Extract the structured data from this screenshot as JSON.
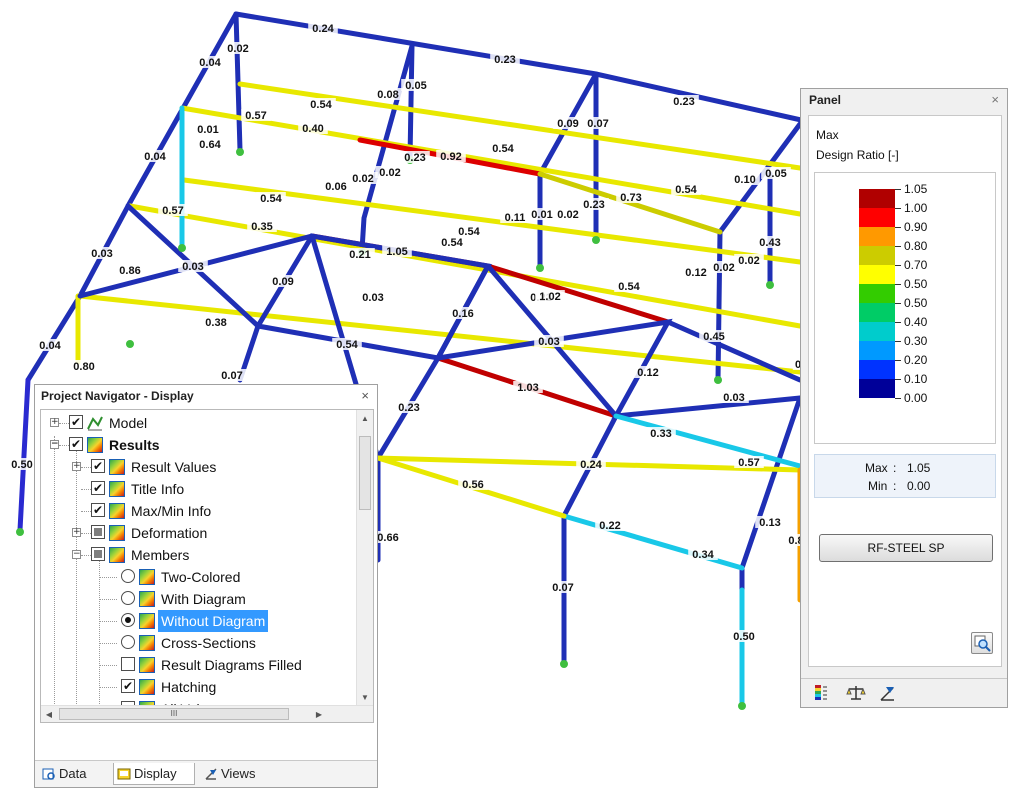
{
  "model": {
    "labels": [
      "0.24",
      "0.23",
      "0.23",
      "0.02",
      "0.04",
      "0.05",
      "0.08",
      "0.54",
      "0.57",
      "0.01",
      "0.64",
      "0.40",
      "0.92",
      "0.54",
      "0.09",
      "0.07",
      "0.10",
      "0.05",
      "0.04",
      "0.02",
      "0.02",
      "0.23",
      "0.06",
      "0.54",
      "0.73",
      "0.54",
      "0.57",
      "0.35",
      "0.11",
      "0.01",
      "0.02",
      "0.23",
      "0.21",
      "1.05",
      "0.54",
      "0.43",
      "0.03",
      "0.86",
      "0.03",
      "0.09",
      "0.02",
      "0.02",
      "0.12",
      "0.21",
      "1.02",
      "0.54",
      "0.54",
      "0.03",
      "0.38",
      "0.16",
      "0.03",
      "0.45",
      "0.04",
      "0.54",
      "0.80",
      "0.07",
      "0.12",
      "1.03",
      "0.23",
      "0.03",
      "0.50",
      "0.33",
      "0.57",
      "0.24",
      "0.56",
      "0.66",
      "0.22",
      "0.13",
      "0.34",
      "0.07",
      "0.50",
      "0.8",
      "0"
    ]
  },
  "navigator": {
    "title": "Project Navigator - Display",
    "close": "×",
    "items": [
      {
        "label": "Model"
      },
      {
        "label": "Results"
      },
      {
        "label": "Result Values"
      },
      {
        "label": "Title Info"
      },
      {
        "label": "Max/Min Info"
      },
      {
        "label": "Deformation"
      },
      {
        "label": "Members"
      },
      {
        "label": "Two-Colored"
      },
      {
        "label": "With Diagram"
      },
      {
        "label": "Without Diagram"
      },
      {
        "label": "Cross-Sections"
      },
      {
        "label": "Result Diagrams Filled"
      },
      {
        "label": "Hatching"
      },
      {
        "label": "All Values"
      }
    ],
    "tabs": [
      {
        "label": "Data"
      },
      {
        "label": "Display"
      },
      {
        "label": "Views"
      }
    ],
    "scroll_marker": "III"
  },
  "panel": {
    "title": "Panel",
    "close": "×",
    "heading1": "Max",
    "heading2": "Design Ratio [-]",
    "legend": [
      {
        "value": "1.05",
        "color": "#b00000"
      },
      {
        "value": "1.00",
        "color": "#ff0000"
      },
      {
        "value": "0.90",
        "color": "#ff9900"
      },
      {
        "value": "0.80",
        "color": "#cccc00"
      },
      {
        "value": "0.70",
        "color": "#ffff00"
      },
      {
        "value": "0.50",
        "color": "#33cc00"
      },
      {
        "value": "0.50",
        "color": "#00cc66"
      },
      {
        "value": "0.40",
        "color": "#00cccc"
      },
      {
        "value": "0.30",
        "color": "#0099ff"
      },
      {
        "value": "0.20",
        "color": "#0033ff"
      },
      {
        "value": "0.10",
        "color": "#000099"
      },
      {
        "value": "0.00",
        "color": ""
      }
    ],
    "max_label": "Max",
    "max_value": "1.05",
    "min_label": "Min",
    "min_value": "0.00",
    "colon": ":",
    "button": "RF-STEEL SP"
  }
}
